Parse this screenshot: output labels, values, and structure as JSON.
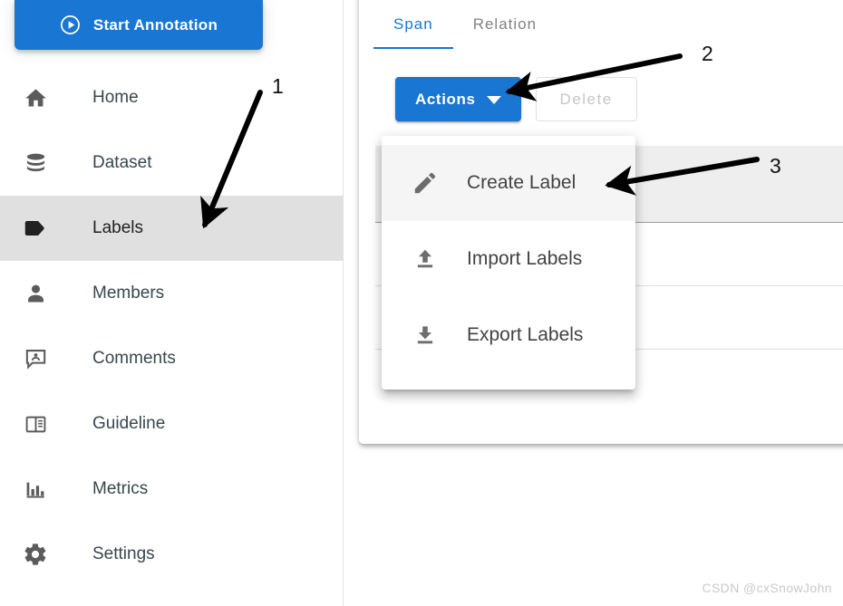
{
  "app": {
    "watermark": "CSDN @cxSnowJohn"
  },
  "sidebar": {
    "start_button": {
      "label": "Start Annotation",
      "icon": "play-circle-icon",
      "color": "#1976d2"
    },
    "items": [
      {
        "label": "Home",
        "icon": "home-icon",
        "active": false
      },
      {
        "label": "Dataset",
        "icon": "database-icon",
        "active": false
      },
      {
        "label": "Labels",
        "icon": "tag-icon",
        "active": true
      },
      {
        "label": "Members",
        "icon": "person-icon",
        "active": false
      },
      {
        "label": "Comments",
        "icon": "comment-icon",
        "active": false
      },
      {
        "label": "Guideline",
        "icon": "book-icon",
        "active": false
      },
      {
        "label": "Metrics",
        "icon": "bar-chart-icon",
        "active": false
      },
      {
        "label": "Settings",
        "icon": "gear-icon",
        "active": false
      }
    ]
  },
  "main": {
    "tabs": [
      {
        "label": "Span",
        "active": true
      },
      {
        "label": "Relation",
        "active": false
      }
    ],
    "toolbar": {
      "actions_label": "Actions",
      "actions_icon": "chevron-down-icon",
      "delete_label": "Delete",
      "delete_disabled": true
    },
    "actions_menu": {
      "items": [
        {
          "label": "Create Label",
          "icon": "pencil-icon",
          "highlighted": true
        },
        {
          "label": "Import Labels",
          "icon": "upload-arrow-icon",
          "highlighted": false
        },
        {
          "label": "Export Labels",
          "icon": "download-arrow-icon",
          "highlighted": false
        }
      ]
    },
    "table": {
      "header_cells": [
        ""
      ],
      "rows": [
        [
          ""
        ],
        [
          ""
        ],
        [
          ""
        ]
      ]
    }
  },
  "annotations": [
    {
      "number": "1",
      "target": "sidebar-item-labels"
    },
    {
      "number": "2",
      "target": "actions-button"
    },
    {
      "number": "3",
      "target": "menu-item-create-label"
    }
  ],
  "colors": {
    "primary": "#1976d2",
    "active_nav_bg": "#e0e0e0",
    "menu_hover_bg": "#f5f5f5",
    "table_header_bg": "#eeeeee"
  }
}
